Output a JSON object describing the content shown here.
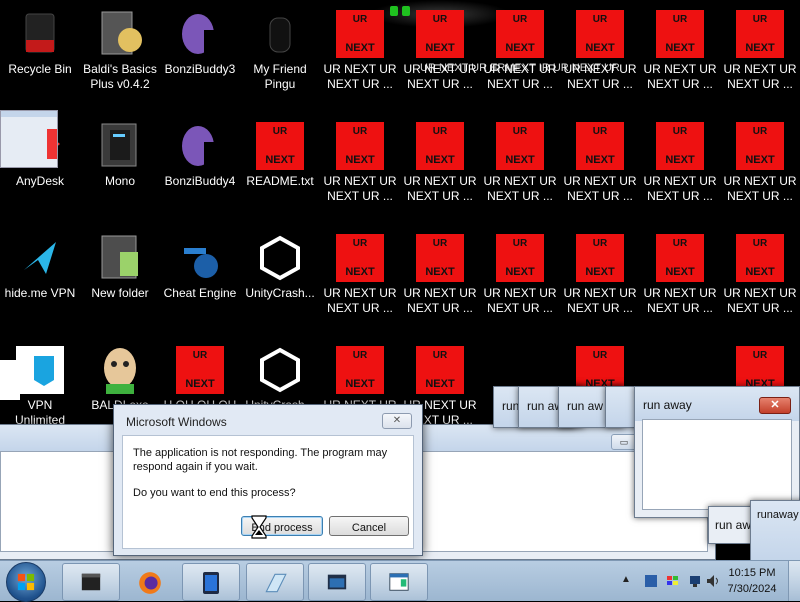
{
  "desktop": {
    "icons": [
      {
        "label": "Recycle Bin",
        "icon": "recycle-bin-icon"
      },
      {
        "label": "Baldi's Basics\nPlus v0.4.2",
        "icon": "folder-icon"
      },
      {
        "label": "BonziBuddy3",
        "icon": "bonzibuddy-icon"
      },
      {
        "label": "My Friend\nPingu",
        "icon": "pingu-icon"
      },
      {
        "label": "AnyDesk",
        "icon": "anydesk-icon"
      },
      {
        "label": "Mono",
        "icon": "mono-icon"
      },
      {
        "label": "BonziBuddy4",
        "icon": "bonzibuddy-icon"
      },
      {
        "label": "README.txt",
        "icon": "text-file-icon"
      },
      {
        "label": "hide.me VPN",
        "icon": "hideme-vpn-icon"
      },
      {
        "label": "New folder",
        "icon": "folder-icon"
      },
      {
        "label": "Cheat Engine",
        "icon": "cheat-engine-icon"
      },
      {
        "label": "UnityCrash...",
        "icon": "unity-icon"
      },
      {
        "label": "VPN\nUnlimited",
        "icon": "vpn-icon"
      },
      {
        "label": "BALDI.exe",
        "icon": "baldi-icon"
      },
      {
        "label": "H OH OH OH",
        "icon": "text-file-icon"
      },
      {
        "label": "UnityCrash...",
        "icon": "unity-icon"
      }
    ],
    "ur_file": {
      "line1": "UR",
      "line2": "NEXT",
      "label": "UR NEXT UR\nNEXT UR ..."
    },
    "overlap_text": "UR NEXT UR  ERMEXT  IR UR NEXT UR"
  },
  "background_window": {
    "minimize": "▭",
    "maximize": "▢",
    "close": "✕"
  },
  "run_away_windows": [
    {
      "title": "run away"
    },
    {
      "title": "run aw"
    },
    {
      "title": "run aw"
    },
    {
      "title": "run away"
    }
  ],
  "side_windows": {
    "run_aw_label": "run aw",
    "runaway_label": "runaway"
  },
  "dialog": {
    "title": "Microsoft Windows",
    "message": "The application is not responding. The program may respond again if you wait.",
    "question": "Do you want to end this process?",
    "end_button": "End process",
    "cancel_button": "Cancel",
    "close": "✕"
  },
  "taskbar": {
    "clock_time": "10:15 PM",
    "clock_date": "7/30/2024"
  },
  "colors": {
    "ur_red": "#ee1111",
    "taskbar": "#a9c2da"
  }
}
